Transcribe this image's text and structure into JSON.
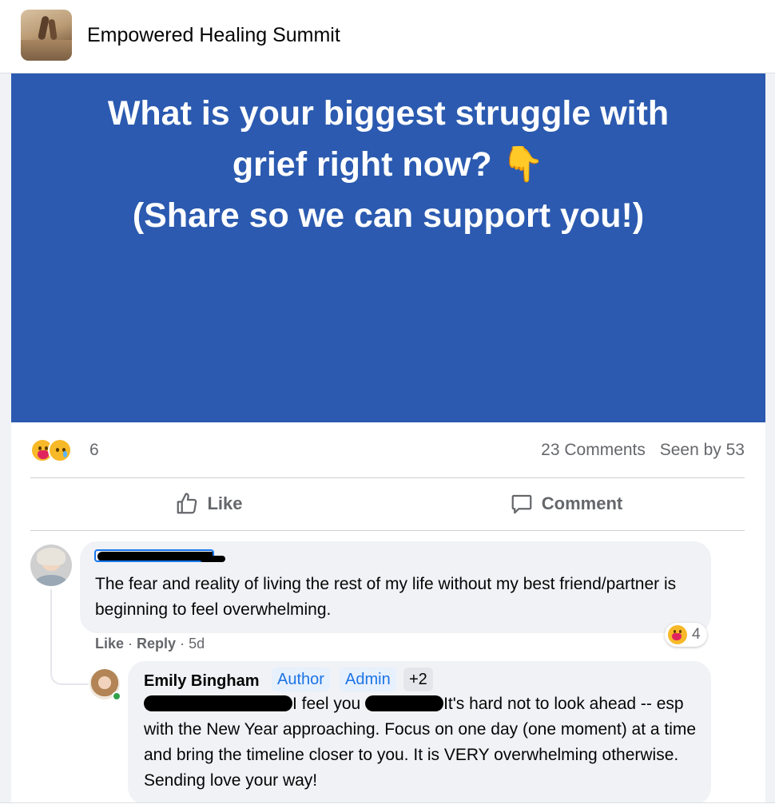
{
  "header": {
    "group_name": "Empowered Healing Summit"
  },
  "post": {
    "banner_lines": [
      "What is your biggest struggle with",
      "grief right now? 👇",
      "(Share so we can support you!)"
    ],
    "banner_color": "#2b5ab0",
    "reaction_icons": [
      "hug-reaction-icon",
      "sad-reaction-icon"
    ],
    "reaction_count": "6",
    "comments_count": "23 Comments",
    "seen_by": "Seen by 53",
    "actions": {
      "like": "Like",
      "comment": "Comment"
    }
  },
  "comments": [
    {
      "author": "[redacted]",
      "text": "The fear and reality of living the rest of my life without my best friend/partner is beginning to feel overwhelming.",
      "reaction_count": "4",
      "like": "Like",
      "reply": "Reply",
      "age": "5d"
    },
    {
      "author": "Emily Bingham",
      "badges": [
        "Author",
        "Admin",
        "+2"
      ],
      "text_parts": [
        "I feel you ",
        "It's hard not to look ahead -- esp with the New Year approaching. Focus on one day (one moment) at a time and bring the timeline closer to you. It is VERY overwhelming otherwise. Sending love your way!"
      ]
    }
  ],
  "colors": {
    "accent": "#1b74e4",
    "muted_text": "#65676b",
    "bubble": "#f0f2f5",
    "online": "#31a24c"
  }
}
